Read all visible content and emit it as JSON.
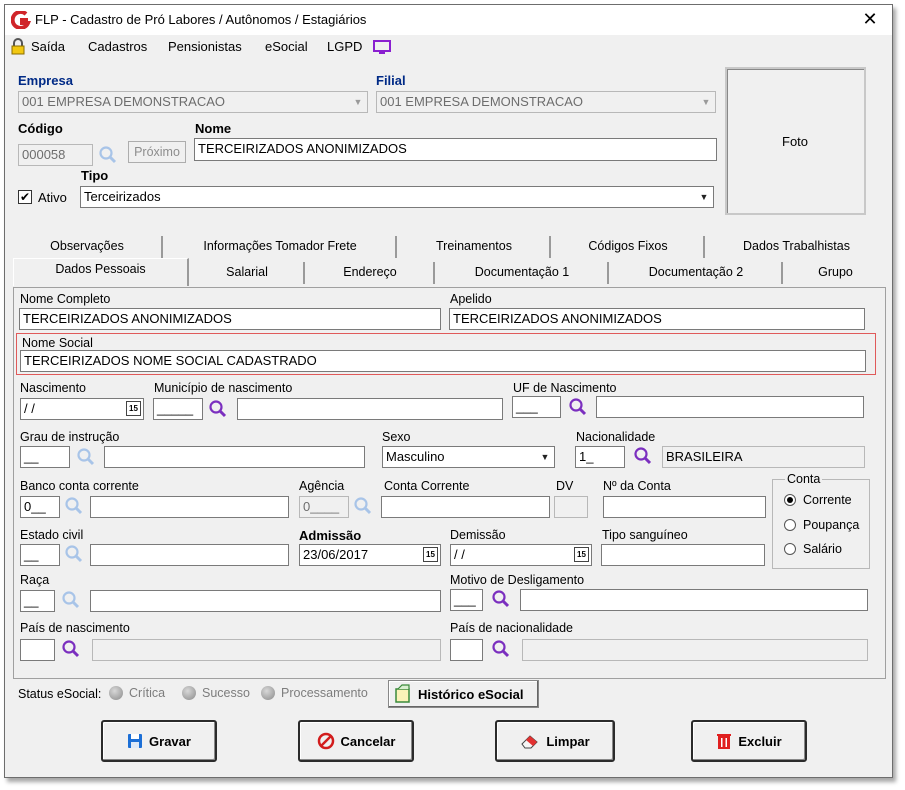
{
  "window": {
    "title": "FLP - Cadastro de Pró Labores / Autônomos / Estagiários"
  },
  "menu": {
    "items": [
      "Saída",
      "Cadastros",
      "Pensionistas",
      "eSocial",
      "LGPD"
    ]
  },
  "header": {
    "empresa_label": "Empresa",
    "empresa_value": "001 EMPRESA DEMONSTRACAO",
    "filial_label": "Filial",
    "filial_value": "001 EMPRESA DEMONSTRACAO",
    "codigo_label": "Código",
    "codigo_value": "000058",
    "proximo_label": "Próximo",
    "nome_label": "Nome",
    "nome_value": "TERCEIRIZADOS ANONIMIZADOS",
    "ativo_label": "Ativo",
    "tipo_label": "Tipo",
    "tipo_value": "Terceirizados",
    "foto_label": "Foto"
  },
  "tabs_row1": [
    "Observações",
    "Informações Tomador Frete",
    "Treinamentos",
    "Códigos Fixos",
    "Dados Trabalhistas"
  ],
  "tabs_row2": [
    "Dados Pessoais",
    "Salarial",
    "Endereço",
    "Documentação 1",
    "Documentação 2",
    "Grupo"
  ],
  "form": {
    "nome_completo_label": "Nome Completo",
    "nome_completo_value": "TERCEIRIZADOS ANONIMIZADOS",
    "apelido_label": "Apelido",
    "apelido_value": "TERCEIRIZADOS ANONIMIZADOS",
    "nome_social_label": "Nome Social",
    "nome_social_value": "TERCEIRIZADOS NOME SOCIAL CADASTRADO",
    "nascimento_label": "Nascimento",
    "nascimento_value": " / /",
    "municipio_label": "Município de nascimento",
    "uf_label": "UF de Nascimento",
    "grau_label": "Grau de instrução",
    "sexo_label": "Sexo",
    "sexo_value": "Masculino",
    "nacionalidade_label": "Nacionalidade",
    "nacionalidade_code": "1_",
    "nacionalidade_value": "BRASILEIRA",
    "banco_label": "Banco conta corrente",
    "banco_value": "0__",
    "agencia_label": "Agência",
    "agencia_value": "0____",
    "conta_corrente_label": "Conta Corrente",
    "dv_label": "DV",
    "num_conta_label": "Nº da Conta",
    "conta_group_label": "Conta",
    "conta_options": [
      "Corrente",
      "Poupança",
      "Salário"
    ],
    "estado_civil_label": "Estado civil",
    "admissao_label": "Admissão",
    "admissao_value": "23/06/2017",
    "demissao_label": "Demissão",
    "demissao_value": " / /",
    "tipo_sanguineo_label": "Tipo sanguíneo",
    "raca_label": "Raça",
    "motivo_label": "Motivo de Desligamento",
    "pais_nasc_label": "País de nascimento",
    "pais_nac_label": "País de nacionalidade"
  },
  "status": {
    "label": "Status eSocial:",
    "items": [
      "Crítica",
      "Sucesso",
      "Processamento"
    ],
    "historico_label": "Histórico eSocial"
  },
  "buttons": {
    "gravar": "Gravar",
    "cancelar": "Cancelar",
    "limpar": "Limpar",
    "excluir": "Excluir"
  },
  "colors": {
    "highlight_border": "#e05a5a",
    "label_blue": "#002a86",
    "search_icon": "#7b2fbf"
  }
}
